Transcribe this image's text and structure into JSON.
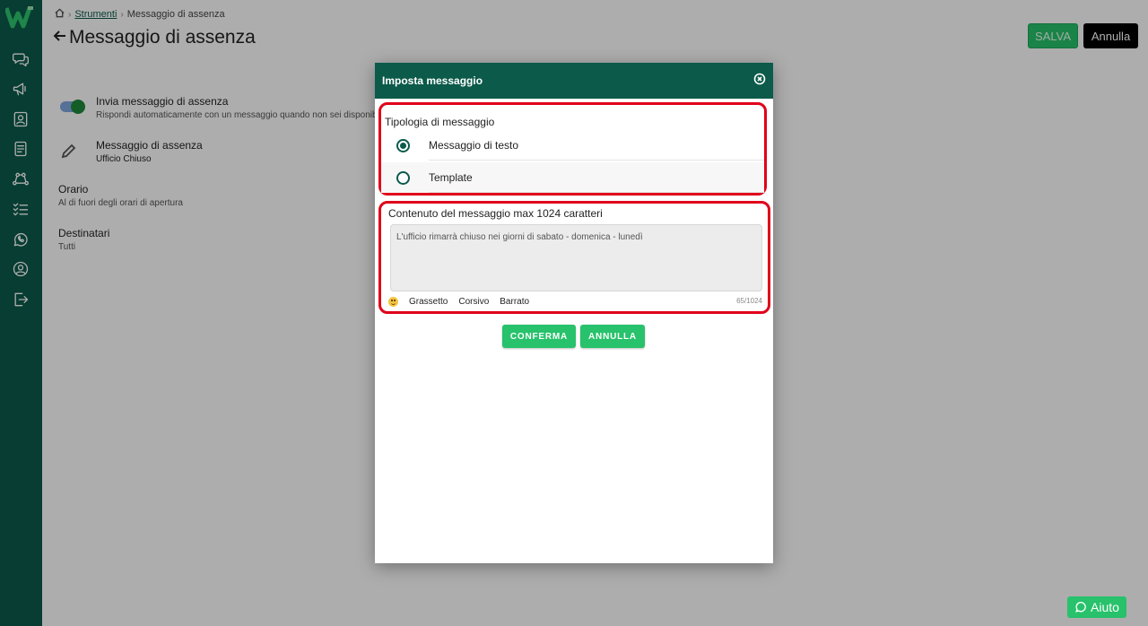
{
  "breadcrumb": {
    "tools_label": "Strumenti",
    "current": "Messaggio di assenza"
  },
  "page": {
    "title": "Messaggio di assenza"
  },
  "actions": {
    "save_label": "SALVA",
    "cancel_label": "Annulla"
  },
  "settings": {
    "away": {
      "title": "Invia messaggio di assenza",
      "subtitle": "Rispondi automaticamente con un messaggio quando non sei disponibile",
      "enabled": true
    },
    "message": {
      "title": "Messaggio di assenza",
      "subtitle": "Ufficio Chiuso"
    },
    "schedule": {
      "title": "Orario",
      "subtitle": "Al di fuori degli orari di apertura"
    },
    "recipients": {
      "title": "Destinatari",
      "subtitle": "Tutti"
    }
  },
  "modal": {
    "title": "Imposta messaggio",
    "type_label": "Tipologia di messaggio",
    "options": [
      {
        "label": "Messaggio di testo",
        "checked": true
      },
      {
        "label": "Template",
        "checked": false
      }
    ],
    "content_label": "Contenuto del messaggio max 1024 caratteri",
    "content_value": "L'ufficio rimarrà chiuso nei giorni di sabato - domenica - lunedì",
    "format": {
      "bold": "Grassetto",
      "italic": "Corsivo",
      "strike": "Barrato"
    },
    "counter": "65/1024",
    "confirm_label": "CONFERMA",
    "cancel_label": "ANNULLA"
  },
  "help": {
    "label": "Aiuto"
  },
  "colors": {
    "brand": "#0b5a4a",
    "accent": "#27c26b",
    "highlight": "#e0001a"
  }
}
